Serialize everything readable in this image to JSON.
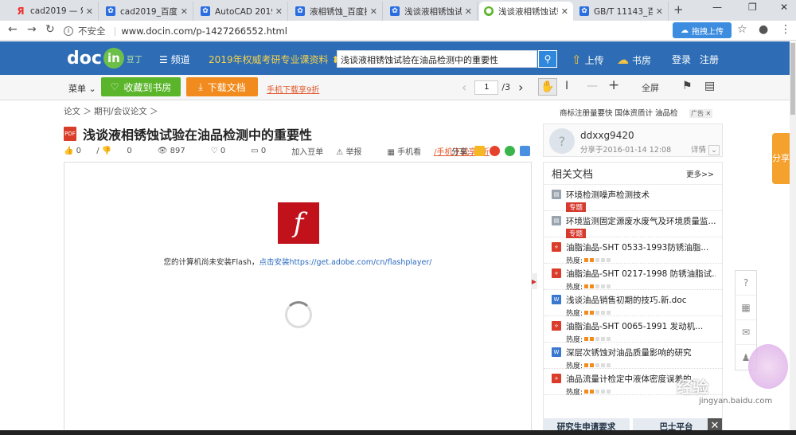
{
  "browser": {
    "tabs": [
      {
        "title": "cad2019 — Яндекс",
        "favicon_color": "#e33"
      },
      {
        "title": "cad2019_百度搜索",
        "favicon_color": "#2a6de0"
      },
      {
        "title": "AutoCAD 2019安装",
        "favicon_color": "#2a6de0"
      },
      {
        "title": "液相锈蚀_百度搜索",
        "favicon_color": "#2a6de0"
      },
      {
        "title": "浅谈液相锈蚀试验",
        "favicon_color": "#2a6de0"
      },
      {
        "title": "浅谈液相锈蚀试验",
        "favicon_color": "#5ab52a"
      },
      {
        "title": "GB/T 11143_百度",
        "favicon_color": "#2a6de0"
      }
    ],
    "new_tab": "+",
    "controls": {
      "minimize": "—",
      "restore": "❐",
      "close": "✕"
    },
    "security_label": "不安全",
    "url": "www.docin.com/p-1427266552.html",
    "ext_button": "拖拽上传"
  },
  "header": {
    "logo_text": "doc",
    "logo_in": "in",
    "logo_cn": "豆丁",
    "channels_label": "频道",
    "promo": "2019年权威考研专业课资料",
    "search_value": "浅谈液相锈蚀试验在油品检测中的重要性",
    "upload_label": "上传",
    "bookshelf_label": "书房",
    "login_label": "登录",
    "register_label": "注册"
  },
  "toolbar": {
    "menu_label": "菜单",
    "collect_label": "收藏到书房",
    "download_label": "下载文档",
    "mobile_link": "手机下载享9折",
    "page_current": "1",
    "page_total": "/3",
    "fullscreen_label": "全屏"
  },
  "breadcrumb": "论文 ＞ 期刊/会议论文 ＞",
  "ads": "商标注册量要快  国体资质计  油品检",
  "ad_tag": "广告",
  "document": {
    "pdf_label": "PDF",
    "title": "浅谈液相锈蚀试验在油品检测中的重要性",
    "likes": "0",
    "dislikes": "0",
    "views": "897",
    "favorites": "0",
    "comments": "0",
    "add_to_list": "加入豆单",
    "report": "举报",
    "mobile_view": "手机看",
    "mobile_download": "/手机下载享9折",
    "share_label": "分享:"
  },
  "viewer": {
    "flash_message": "您的计算机尚未安装Flash，",
    "flash_link": "点击安装https://get.adobe.com/cn/flashplayer/"
  },
  "uploader": {
    "name": "ddxxg9420",
    "shared": "分享于2016-01-14 12:08",
    "details": "详情"
  },
  "related": {
    "heading": "相关文档",
    "more": "更多>>",
    "items": [
      {
        "title": "环境检测噪声检测技术",
        "tag": "专题",
        "type": "doc",
        "heat": ""
      },
      {
        "title": "环境监测固定源废水废气及环境质量监...",
        "tag": "专题",
        "type": "doc",
        "heat": ""
      },
      {
        "title": "油脂油品-SHT 0533-1993防锈油脂...",
        "tag": "",
        "type": "pdf",
        "heat": "热度:"
      },
      {
        "title": "油脂油品-SHT 0217-1998 防锈油脂试...",
        "tag": "",
        "type": "pdf",
        "heat": "热度:"
      },
      {
        "title": "浅谈油品销售初期的技巧.新.doc",
        "tag": "",
        "type": "word",
        "heat": "热度:"
      },
      {
        "title": "油脂油品-SHT 0065-1991 发动机...",
        "tag": "",
        "type": "pdf",
        "heat": "热度:"
      },
      {
        "title": "深层次锈蚀对油品质量影响的研究",
        "tag": "",
        "type": "word",
        "heat": "热度:"
      },
      {
        "title": "油品流量计检定中液体密度误差的...",
        "tag": "",
        "type": "pdf",
        "heat": "热度:"
      }
    ]
  },
  "footer_boxes": [
    "研究生申请要求",
    "巴士平台"
  ],
  "share_tab": "分享",
  "watermark": "经验",
  "watermark_url": "jingyan.baidu.com"
}
